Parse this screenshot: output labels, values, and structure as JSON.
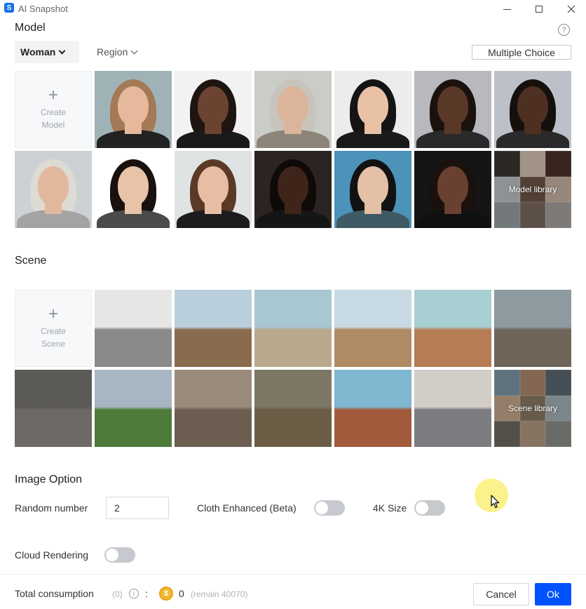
{
  "window": {
    "title": "AI Snapshot",
    "app_icon": "S"
  },
  "model": {
    "section_title": "Model",
    "help_icon_text": "?",
    "filters": {
      "gender_label": "Woman",
      "region_label": "Region"
    },
    "multiple_choice_label": "Multiple Choice",
    "create_tile": {
      "plus": "+",
      "line1": "Create",
      "line2": "Model"
    },
    "library_label": "Model library",
    "tiles": [
      {
        "name": "model-portrait-1",
        "bg": "#9fb3b7",
        "skin": "#e6b99c",
        "hair": "#a37956",
        "top": "#222222"
      },
      {
        "name": "model-portrait-2",
        "bg": "#f2f2f2",
        "skin": "#6b4330",
        "hair": "#1e1410",
        "top": "#1a1a1a"
      },
      {
        "name": "model-portrait-3",
        "bg": "#c9ccc7",
        "skin": "#dcb49b",
        "hair": "#c8c4bc",
        "top": "#8c8478"
      },
      {
        "name": "model-portrait-4",
        "bg": "#ececec",
        "skin": "#e9c2a6",
        "hair": "#141414",
        "top": "#1a1a1a"
      },
      {
        "name": "model-portrait-5",
        "bg": "#b8b9bd",
        "skin": "#5a3828",
        "hair": "#1b120e",
        "top": "#2a2a2a"
      },
      {
        "name": "model-portrait-6",
        "bg": "#bcc1c9",
        "skin": "#4d3022",
        "hair": "#15100c",
        "top": "#2a2a2a"
      },
      {
        "name": "model-portrait-7",
        "bg": "#cdd1d4",
        "skin": "#e2b89d",
        "hair": "#dedad4",
        "top": "#a3a3a3"
      },
      {
        "name": "model-portrait-8",
        "bg": "#ffffff",
        "skin": "#e8c3a8",
        "hair": "#18110d",
        "top": "#4a4a4a"
      },
      {
        "name": "model-portrait-9",
        "bg": "#e0e3e4",
        "skin": "#e7bea3",
        "hair": "#5a3a26",
        "top": "#1c1c1c"
      },
      {
        "name": "model-portrait-10",
        "bg": "#2b2422",
        "skin": "#3f2519",
        "hair": "#0e0a08",
        "top": "#151515"
      },
      {
        "name": "model-portrait-11",
        "bg": "#4b93b8",
        "skin": "#e3c0a6",
        "hair": "#121212",
        "top": "#3f5a64"
      },
      {
        "name": "model-portrait-12",
        "bg": "#151515",
        "skin": "#6a4030",
        "hair": "#1a110c",
        "top": "#101010"
      }
    ]
  },
  "scene": {
    "section_title": "Scene",
    "create_tile": {
      "plus": "+",
      "line1": "Create",
      "line2": "Scene"
    },
    "library_label": "Scene library",
    "tiles": [
      {
        "name": "scene-mannequin-studio",
        "sky": "#e6e6e6",
        "ground": "#8a8a8a"
      },
      {
        "name": "scene-mosque-tower",
        "sky": "#b9cfdc",
        "ground": "#8b6b4d"
      },
      {
        "name": "scene-rocky-beach",
        "sky": "#a9c6d3",
        "ground": "#b9a88e"
      },
      {
        "name": "scene-old-town-street",
        "sky": "#c7d9e3",
        "ground": "#b08a62"
      },
      {
        "name": "scene-desert-hills",
        "sky": "#a8cfd2",
        "ground": "#b67c54"
      },
      {
        "name": "scene-wooden-pier",
        "sky": "#8d9aa0",
        "ground": "#6e6558"
      },
      {
        "name": "scene-city-street",
        "sky": "#5c5a57",
        "ground": "#6d6a66"
      },
      {
        "name": "scene-chateau-lawn",
        "sky": "#a8b6c4",
        "ground": "#4e7a3a"
      },
      {
        "name": "scene-stone-archway",
        "sky": "#9a8b7c",
        "ground": "#6b5d50"
      },
      {
        "name": "scene-autumn-forest",
        "sky": "#7d7766",
        "ground": "#6a5c45"
      },
      {
        "name": "scene-red-canyon",
        "sky": "#7fb6d0",
        "ground": "#a25a3a"
      },
      {
        "name": "scene-narrow-road",
        "sky": "#d2cdc6",
        "ground": "#7c7d80"
      }
    ]
  },
  "image_option": {
    "section_title": "Image Option",
    "random_number_label": "Random number",
    "random_number_value": "2",
    "cloth_enhanced_label": "Cloth Enhanced (Beta)",
    "size_4k_label": "4K Size",
    "cloud_rendering_label": "Cloud Rendering"
  },
  "footer": {
    "total_label": "Total consumption",
    "count": "(0)",
    "info_icon": "i",
    "colon": ":",
    "coin_symbol": "$",
    "amount": "0",
    "remain": "(remain 40070)",
    "cancel_label": "Cancel",
    "ok_label": "Ok"
  },
  "colors": {
    "accent": "#0052ff",
    "toggle_off": "#c6c9ce",
    "coin": "#f2b632"
  }
}
